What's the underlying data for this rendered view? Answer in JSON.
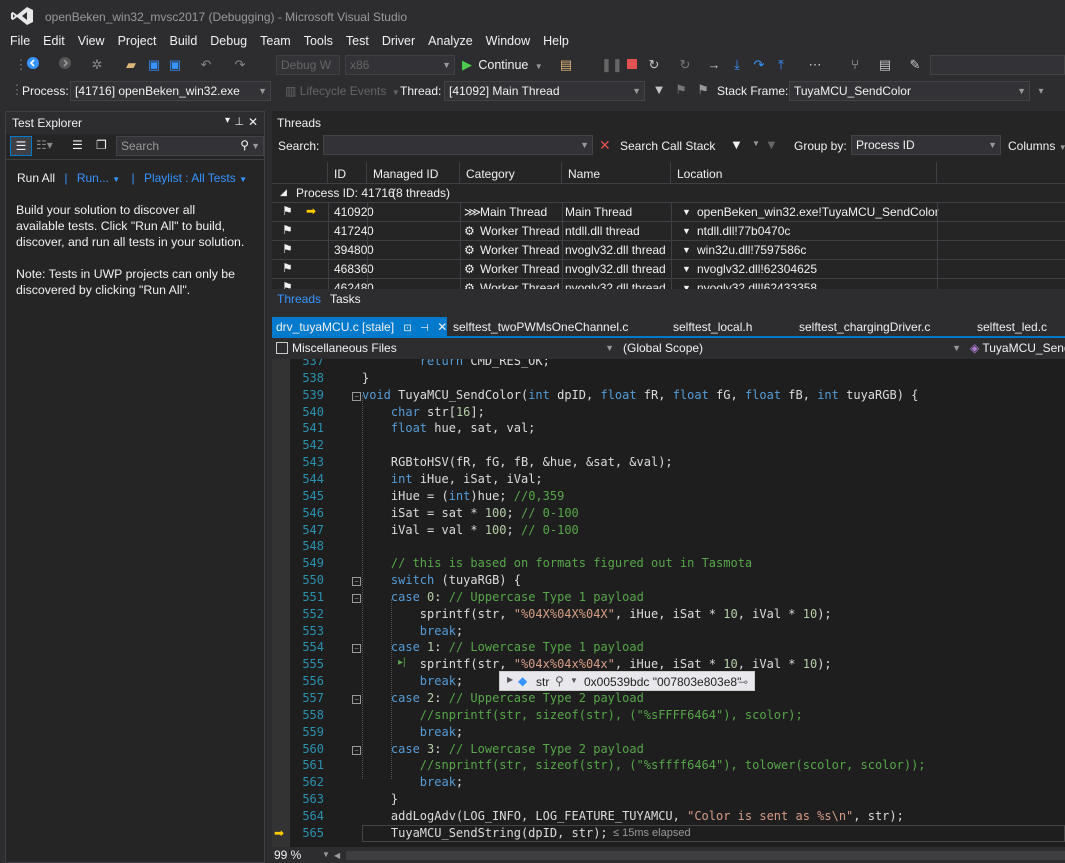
{
  "window": {
    "title": "openBeken_win32_mvsc2017 (Debugging) - Microsoft Visual Studio"
  },
  "menu": [
    "File",
    "Edit",
    "View",
    "Project",
    "Build",
    "Debug",
    "Team",
    "Tools",
    "Test",
    "Driver",
    "Analyze",
    "Window",
    "Help"
  ],
  "toolbar": {
    "config": "Debug W",
    "platform": "x86",
    "continue_label": "Continue",
    "process_label": "Process:",
    "process_value": "[41716] openBeken_win32.exe",
    "lifecycle_label": "Lifecycle Events",
    "thread_label": "Thread:",
    "thread_value": "[41092] Main Thread",
    "stackframe_label": "Stack Frame:",
    "stackframe_value": "TuyaMCU_SendColor"
  },
  "test_explorer": {
    "title": "Test Explorer",
    "search_placeholder": "Search",
    "run_all": "Run All",
    "run": "Run...",
    "playlist": "Playlist : All Tests",
    "msg1": "Build your solution to discover all available tests. Click \"Run All\" to build, discover, and run all tests in your solution.",
    "msg2": "Note: Tests in UWP projects can only be discovered by clicking \"Run All\"."
  },
  "threads": {
    "title": "Threads",
    "search_label": "Search:",
    "search_call_stack": "Search Call Stack",
    "group_by_label": "Group by:",
    "group_by_value": "Process ID",
    "columns_label": "Columns",
    "headers": [
      "ID",
      "Managed ID",
      "Category",
      "Name",
      "Location"
    ],
    "group_label": "Process ID: 41716",
    "group_count": "(8 threads)",
    "rows": [
      {
        "id": "41092",
        "managed": "0",
        "category": "Main Thread",
        "name": "Main Thread",
        "location": "openBeken_win32.exe!TuyaMCU_SendColor"
      },
      {
        "id": "41724",
        "managed": "0",
        "category": "Worker Thread",
        "name": "ntdll.dll thread",
        "location": "ntdll.dll!77b0470c"
      },
      {
        "id": "39480",
        "managed": "0",
        "category": "Worker Thread",
        "name": "nvoglv32.dll thread",
        "location": "win32u.dll!7597586c"
      },
      {
        "id": "46836",
        "managed": "0",
        "category": "Worker Thread",
        "name": "nvoglv32.dll thread",
        "location": "nvoglv32.dll!62304625"
      },
      {
        "id": "46248",
        "managed": "0",
        "category": "Worker Thread",
        "name": "nvoglv32.dll thread",
        "location": "nvoglv32.dll!62433358"
      }
    ],
    "tab_threads": "Threads",
    "tab_tasks": "Tasks"
  },
  "doc_tabs": [
    "drv_tuyaMCU.c [stale]",
    "selftest_twoPWMsOneChannel.c",
    "selftest_local.h",
    "selftest_chargingDriver.c",
    "selftest_led.c"
  ],
  "nav": {
    "project": "Miscellaneous Files",
    "scope": "(Global Scope)",
    "member": "TuyaMCU_Send"
  },
  "code_lines": [
    {
      "n": "537",
      "t": "        return CMD_RES_OK;"
    },
    {
      "n": "538",
      "t": "}"
    },
    {
      "n": "539",
      "t": "void TuyaMCU_SendColor(int dpID, float fR, float fG, float fB, int tuyaRGB) {"
    },
    {
      "n": "540",
      "t": "    char str[16];"
    },
    {
      "n": "541",
      "t": "    float hue, sat, val;"
    },
    {
      "n": "542",
      "t": ""
    },
    {
      "n": "543",
      "t": "    RGBtoHSV(fR, fG, fB, &hue, &sat, &val);"
    },
    {
      "n": "544",
      "t": "    int iHue, iSat, iVal;"
    },
    {
      "n": "545",
      "t": "    iHue = (int)hue; //0,359"
    },
    {
      "n": "546",
      "t": "    iSat = sat * 100; // 0-100"
    },
    {
      "n": "547",
      "t": "    iVal = val * 100; // 0-100"
    },
    {
      "n": "548",
      "t": ""
    },
    {
      "n": "549",
      "t": "    // this is based on formats figured out in Tasmota"
    },
    {
      "n": "550",
      "t": "    switch (tuyaRGB) {"
    },
    {
      "n": "551",
      "t": "    case 0: // Uppercase Type 1 payload"
    },
    {
      "n": "552",
      "t": "        sprintf(str, \"%04X%04X%04X\", iHue, iSat * 10, iVal * 10);"
    },
    {
      "n": "553",
      "t": "        break;"
    },
    {
      "n": "554",
      "t": "    case 1: // Lowercase Type 1 payload"
    },
    {
      "n": "555",
      "t": "        sprintf(str, \"%04x%04x%04x\", iHue, iSat * 10, iVal * 10);"
    },
    {
      "n": "556",
      "t": "        break;"
    },
    {
      "n": "557",
      "t": "    case 2: // Uppercase Type 2 payload"
    },
    {
      "n": "558",
      "t": "        //snprintf(str, sizeof(str), (\"%sFFFF6464\"), scolor);"
    },
    {
      "n": "559",
      "t": "        break;"
    },
    {
      "n": "560",
      "t": "    case 3: // Lowercase Type 2 payload"
    },
    {
      "n": "561",
      "t": "        //snprintf(str, sizeof(str), (\"%sffff6464\"), tolower(scolor, scolor));"
    },
    {
      "n": "562",
      "t": "        break;"
    },
    {
      "n": "563",
      "t": "    }"
    },
    {
      "n": "564",
      "t": "    addLogAdv(LOG_INFO, LOG_FEATURE_TUYAMCU, \"Color is sent as %s\\n\", str);"
    },
    {
      "n": "565",
      "t": "    TuyaMCU_SendString(dpID, str);"
    }
  ],
  "elapsed": "≤ 15ms elapsed",
  "datatip": {
    "name": "str",
    "value": "0x00539bdc \"007803e803e8\""
  },
  "zoom": "99 %"
}
